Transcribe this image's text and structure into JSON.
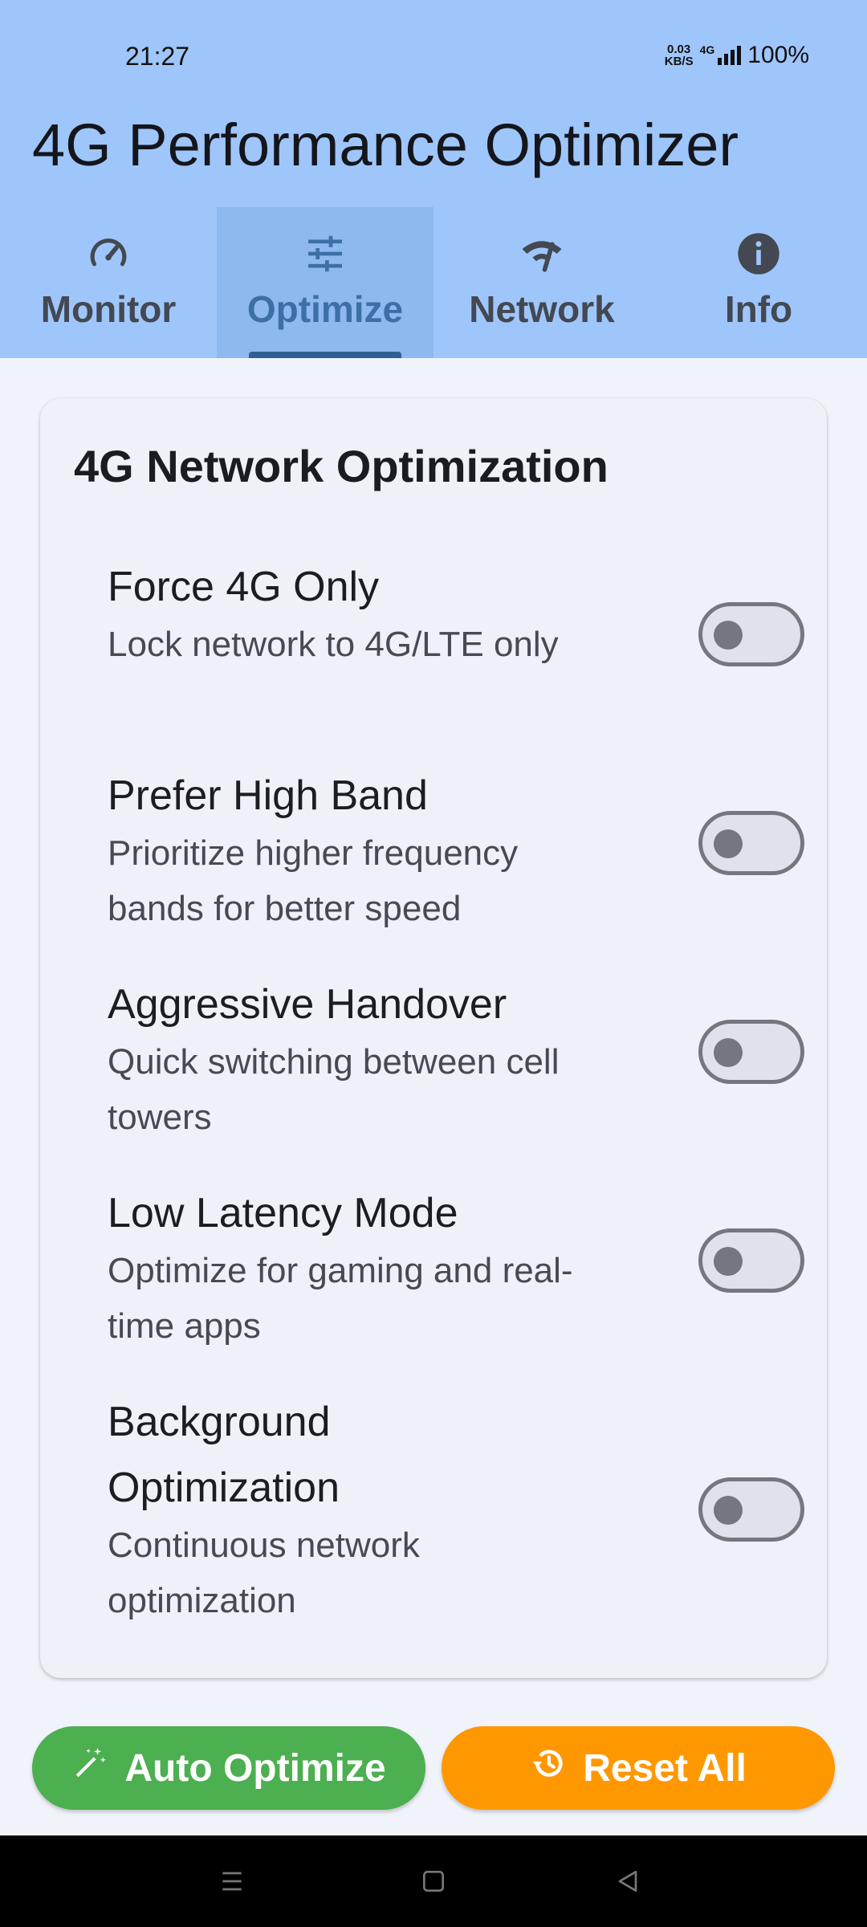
{
  "status_bar": {
    "time": "21:27",
    "net_speed_value": "0.03",
    "net_speed_unit": "KB/S",
    "network_type": "4G",
    "battery": "100%"
  },
  "app": {
    "title": "4G Performance Optimizer"
  },
  "tabs": [
    {
      "label": "Monitor",
      "icon": "speedometer-icon",
      "active": false
    },
    {
      "label": "Optimize",
      "icon": "tune-sliders-icon",
      "active": true
    },
    {
      "label": "Network",
      "icon": "network-wifi-icon",
      "active": false
    },
    {
      "label": "Info",
      "icon": "info-icon",
      "active": false
    }
  ],
  "card": {
    "title": "4G Network Optimization",
    "options": [
      {
        "title": "Force 4G Only",
        "description": "Lock network to 4G/LTE only",
        "enabled": false
      },
      {
        "title": "Prefer High Band",
        "description": "Prioritize higher frequency bands for better speed",
        "enabled": false
      },
      {
        "title": "Aggressive Handover",
        "description": "Quick switching between cell towers",
        "enabled": false
      },
      {
        "title": "Low Latency Mode",
        "description": "Optimize for gaming and real-time apps",
        "enabled": false
      },
      {
        "title": "Background Optimization",
        "description": "Continuous network optimization",
        "enabled": false
      }
    ]
  },
  "actions": {
    "auto_optimize_label": "Auto Optimize",
    "reset_all_label": "Reset All"
  },
  "colors": {
    "header": "#9fc6fb",
    "active_tab": "#8db8f0",
    "auto_optimize": "#4caf50",
    "reset_all": "#ff9800"
  }
}
